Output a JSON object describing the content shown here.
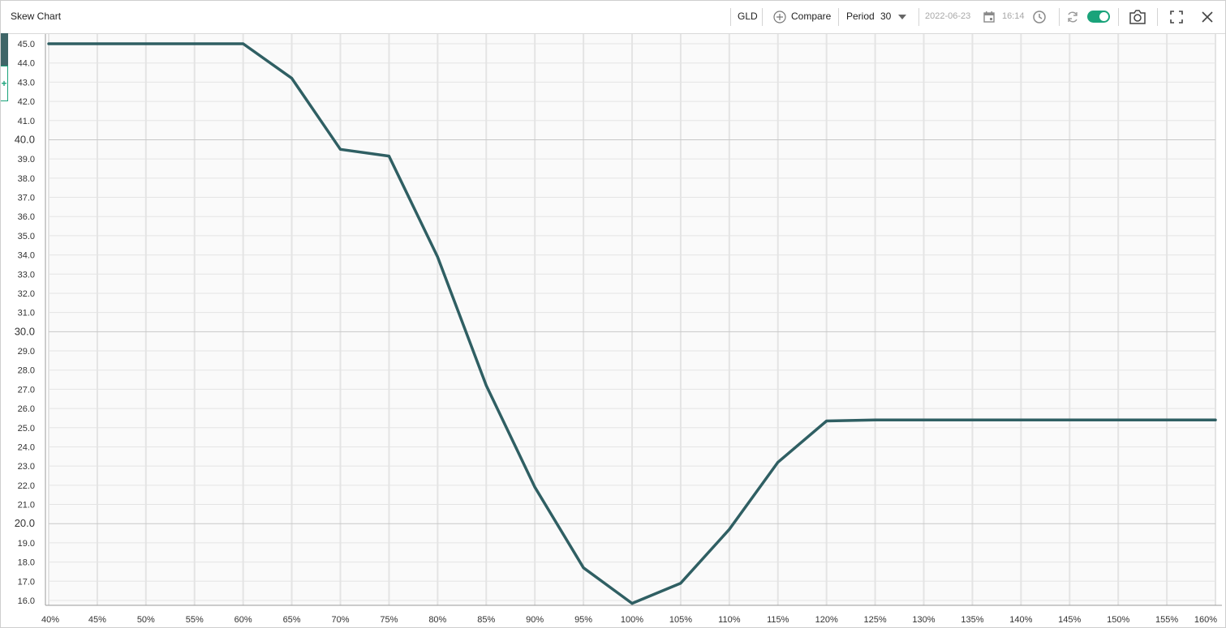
{
  "window": {
    "title": "Skew Chart"
  },
  "toolbar": {
    "symbol": "GLD",
    "compare_label": "Compare",
    "period_label": "Period",
    "period_value": "30",
    "date": "2022-06-23",
    "time": "16:14",
    "toggle_on": true
  },
  "colors": {
    "line": "#2f5f63",
    "accent": "#1aa37a",
    "grid": "#e4e4e4",
    "major_grid": "#c8c8c8"
  },
  "chart_data": {
    "type": "line",
    "title": "",
    "xlabel": "",
    "ylabel": "",
    "x": [
      40,
      60,
      65,
      70,
      75,
      80,
      85,
      90,
      95,
      100,
      105,
      110,
      115,
      120,
      125,
      160
    ],
    "series": [
      {
        "values": [
          45.0,
          45.0,
          43.2,
          39.5,
          39.15,
          33.9,
          27.2,
          21.9,
          17.7,
          15.85,
          16.9,
          19.7,
          23.2,
          25.35,
          25.4,
          25.4
        ]
      }
    ],
    "xlim": [
      40,
      160
    ],
    "ylim": [
      16,
      45
    ],
    "x_ticks": [
      "40%",
      "45%",
      "50%",
      "55%",
      "60%",
      "65%",
      "70%",
      "75%",
      "80%",
      "85%",
      "90%",
      "95%",
      "100%",
      "105%",
      "110%",
      "115%",
      "120%",
      "125%",
      "130%",
      "135%",
      "140%",
      "145%",
      "150%",
      "155%",
      "160%"
    ],
    "y_ticks": [
      "16.0",
      "17.0",
      "18.0",
      "19.0",
      "20.0",
      "21.0",
      "22.0",
      "23.0",
      "24.0",
      "25.0",
      "26.0",
      "27.0",
      "28.0",
      "29.0",
      "30.0",
      "31.0",
      "32.0",
      "33.0",
      "34.0",
      "35.0",
      "36.0",
      "37.0",
      "38.0",
      "39.0",
      "40.0",
      "41.0",
      "42.0",
      "43.0",
      "44.0",
      "45.0"
    ],
    "grid": true
  }
}
